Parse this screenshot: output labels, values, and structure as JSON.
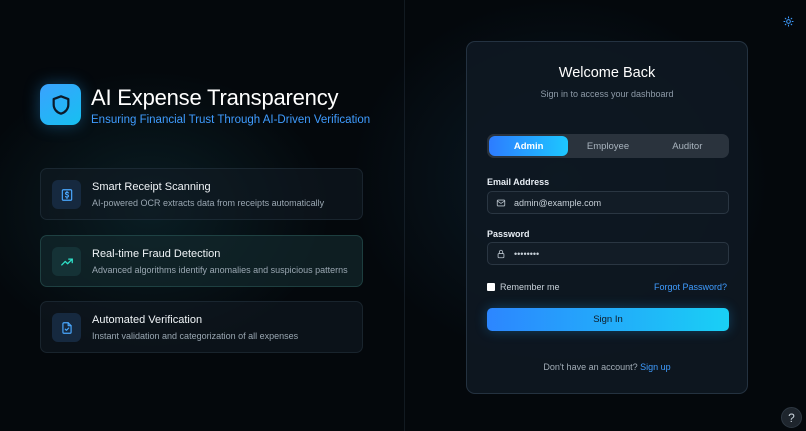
{
  "brand": {
    "title": "AI Expense Transparency",
    "subtitle": "Ensuring Financial Trust Through AI-Driven Verification",
    "icon": "shield-icon"
  },
  "features": [
    {
      "title": "Smart Receipt Scanning",
      "description": "AI-powered OCR extracts data from receipts automatically",
      "icon": "receipt-icon"
    },
    {
      "title": "Real-time Fraud Detection",
      "description": "Advanced algorithms identify anomalies and suspicious patterns",
      "icon": "trending-up-icon"
    },
    {
      "title": "Automated Verification",
      "description": "Instant validation and categorization of all expenses",
      "icon": "file-check-icon"
    }
  ],
  "login": {
    "title": "Welcome Back",
    "subtitle": "Sign in to access your dashboard",
    "roles": [
      "Admin",
      "Employee",
      "Auditor"
    ],
    "active_role": "Admin",
    "email_label": "Email Address",
    "email_placeholder": "admin@example.com",
    "password_label": "Password",
    "password_placeholder": "••••••••",
    "remember_label": "Remember me",
    "forgot_label": "Forgot Password?",
    "signin_label": "Sign In",
    "signup_prompt": "Don't have an account?",
    "signup_link": "Sign up"
  },
  "help_label": "?",
  "colors": {
    "accent": "#3f9cff",
    "accent_gradient_end": "#19d0f5",
    "card_bg": "#0e1822"
  }
}
